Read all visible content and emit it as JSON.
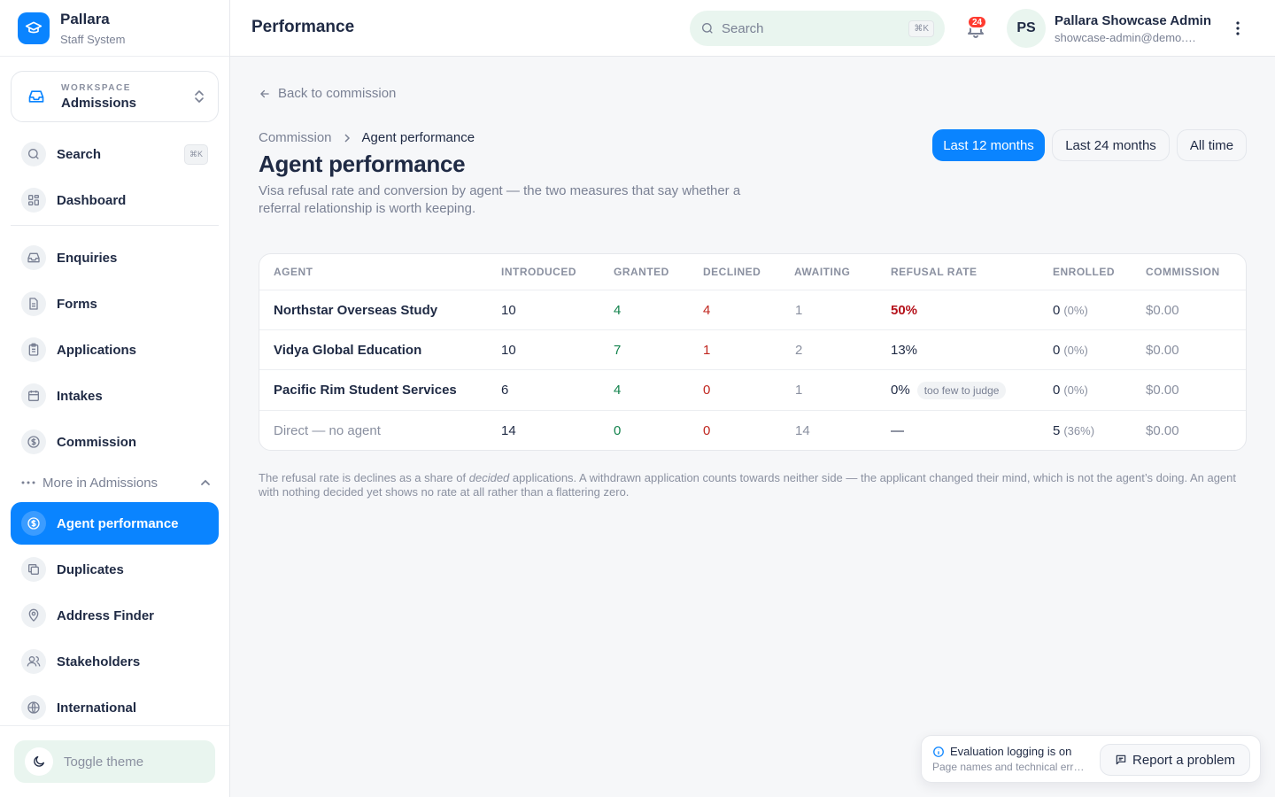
{
  "brand": {
    "name": "Pallara",
    "subtitle": "Staff System"
  },
  "workspace": {
    "label": "WORKSPACE",
    "name": "Admissions"
  },
  "sidebar": {
    "search": {
      "label": "Search",
      "shortcut": "⌘K"
    },
    "items": [
      {
        "label": "Dashboard",
        "icon": "grid-icon"
      },
      {
        "label": "Enquiries",
        "icon": "inbox-icon"
      },
      {
        "label": "Forms",
        "icon": "file-icon"
      },
      {
        "label": "Applications",
        "icon": "clipboard-icon"
      },
      {
        "label": "Intakes",
        "icon": "calendar-icon"
      },
      {
        "label": "Commission",
        "icon": "dollar-icon"
      }
    ],
    "more_label": "More in Admissions",
    "more_items": [
      {
        "label": "Agent performance",
        "icon": "dollar-icon",
        "active": true
      },
      {
        "label": "Duplicates",
        "icon": "copy-icon"
      },
      {
        "label": "Address Finder",
        "icon": "map-pin-icon"
      },
      {
        "label": "Stakeholders",
        "icon": "users-icon"
      },
      {
        "label": "International",
        "icon": "globe-icon"
      }
    ],
    "toggle_theme": "Toggle theme"
  },
  "header": {
    "title": "Performance",
    "search_placeholder": "Search",
    "search_shortcut": "⌘K",
    "notifications_count": "24",
    "user": {
      "initials": "PS",
      "name": "Pallara Showcase Admin",
      "email": "showcase-admin@demo.pallara.app"
    }
  },
  "main": {
    "back_label": "Back to commission",
    "breadcrumb": [
      "Commission",
      "Agent performance"
    ],
    "title": "Agent performance",
    "subtitle": "Visa refusal rate and conversion by agent — the two measures that say whether a referral relationship is worth keeping.",
    "ranges": [
      "Last 12 months",
      "Last 24 months",
      "All time"
    ],
    "active_range": "Last 12 months",
    "table": {
      "columns": [
        "AGENT",
        "INTRODUCED",
        "GRANTED",
        "DECLINED",
        "AWAITING",
        "REFUSAL RATE",
        "ENROLLED",
        "COMMISSION"
      ],
      "rows": [
        {
          "agent": "Northstar Overseas Study",
          "introduced": "10",
          "granted": "4",
          "declined": "4",
          "awaiting": "1",
          "refusal_rate": "50%",
          "refusal_flag": "",
          "enrolled": "0",
          "enrolled_pct": "(0%)",
          "commission": "$0.00"
        },
        {
          "agent": "Vidya Global Education",
          "introduced": "10",
          "granted": "7",
          "declined": "1",
          "awaiting": "2",
          "refusal_rate": "13%",
          "refusal_flag": "",
          "enrolled": "0",
          "enrolled_pct": "(0%)",
          "commission": "$0.00"
        },
        {
          "agent": "Pacific Rim Student Services",
          "introduced": "6",
          "granted": "4",
          "declined": "0",
          "awaiting": "1",
          "refusal_rate": "0%",
          "refusal_flag": "too few to judge",
          "enrolled": "0",
          "enrolled_pct": "(0%)",
          "commission": "$0.00"
        },
        {
          "agent": "Direct — no agent",
          "introduced": "14",
          "granted": "0",
          "declined": "0",
          "awaiting": "14",
          "refusal_rate": "—",
          "refusal_flag": "",
          "enrolled": "5",
          "enrolled_pct": "(36%)",
          "commission": "$0.00"
        }
      ]
    },
    "footnote_before": "The refusal rate is declines as a share of ",
    "footnote_em": "decided",
    "footnote_after": " applications. A withdrawn application counts towards neither side — the applicant changed their mind, which is not the agent’s doing. An agent with nothing decided yet shows no rate at all rather than a flattering zero."
  },
  "toast": {
    "title": "Evaluation logging is on",
    "subtitle": "Page names and technical errors are recorded",
    "report_label": "Report a problem"
  },
  "colors": {
    "accent": "#0a84ff",
    "granted": "#13834d",
    "declined": "#c0261f",
    "badge": "#ff3b30",
    "soft_green": "#e9f5ef"
  }
}
